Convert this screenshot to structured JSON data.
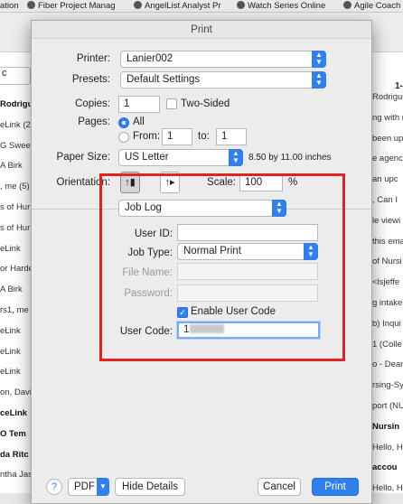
{
  "bookmarks": [
    {
      "label": "ation",
      "icon": "bookmark-icon"
    },
    {
      "label": "Fiber Project Manag",
      "icon": "bookmark-icon"
    },
    {
      "label": "AngelList Analyst Pr",
      "icon": "angellist-icon"
    },
    {
      "label": "Watch Series Online",
      "icon": "bookmark-icon"
    },
    {
      "label": "Agile Coach",
      "icon": "spotify-icon"
    }
  ],
  "background": {
    "search_text": "c",
    "right_header": "1-",
    "left_rows": [
      {
        "text": "Rodrigu",
        "bold": true
      },
      {
        "text": "eLink (2",
        "bold": false
      },
      {
        "text": "G Swee",
        "bold": false
      },
      {
        "text": "A Birk",
        "bold": false
      },
      {
        "text": ", me (5)",
        "bold": false
      },
      {
        "text": "s of Hur",
        "bold": false
      },
      {
        "text": "s of Hur",
        "bold": false
      },
      {
        "text": "eLink",
        "bold": false
      },
      {
        "text": "or Harde",
        "bold": false
      },
      {
        "text": "A Birk",
        "bold": false
      },
      {
        "text": "rs1, me",
        "bold": false
      },
      {
        "text": "eLink",
        "bold": false
      },
      {
        "text": "eLink",
        "bold": false
      },
      {
        "text": "eLink",
        "bold": false
      },
      {
        "text": "on, David",
        "bold": false
      },
      {
        "text": "ceLink",
        "bold": true
      },
      {
        "text": "O Tem",
        "bold": true
      },
      {
        "text": "da Ritc",
        "bold": true
      },
      {
        "text": "ntha Jas",
        "bold": false
      }
    ],
    "right_rows": [
      {
        "text": "Rodrigue",
        "bold": false
      },
      {
        "text": "ng with re",
        "bold": false
      },
      {
        "text": "been upo",
        "bold": false
      },
      {
        "text": "e agenc",
        "bold": false
      },
      {
        "text": "an upc",
        "bold": false
      },
      {
        "text": ", Can I",
        "bold": false
      },
      {
        "text": "le viewi",
        "bold": false
      },
      {
        "text": "this ema",
        "bold": false
      },
      {
        "text": "of Nursi",
        "bold": false
      },
      {
        "text": "<lsjeffe",
        "bold": false
      },
      {
        "text": "g intake",
        "bold": false
      },
      {
        "text": "b) Inqui",
        "bold": false
      },
      {
        "text": "1 (Colle",
        "bold": false
      },
      {
        "text": "o - Dean",
        "bold": false
      },
      {
        "text": "rsing-Sy",
        "bold": false
      },
      {
        "text": "port (NU",
        "bold": false
      },
      {
        "text": "Nursin",
        "bold": true
      },
      {
        "text": "Hello, Hi",
        "bold": false
      },
      {
        "text": "accou",
        "bold": true
      },
      {
        "text": "Hello, H",
        "bold": false
      }
    ]
  },
  "dialog": {
    "title": "Print",
    "printer_label": "Printer:",
    "printer_value": "Lanier002",
    "presets_label": "Presets:",
    "presets_value": "Default Settings",
    "copies_label": "Copies:",
    "copies_value": "1",
    "two_sided_label": "Two-Sided",
    "two_sided_checked": false,
    "pages_label": "Pages:",
    "pages_all_label": "All",
    "pages_from_label": "From:",
    "pages_from_value": "1",
    "pages_to_label": "to:",
    "pages_to_value": "1",
    "paper_size_label": "Paper Size:",
    "paper_size_value": "US Letter",
    "paper_size_desc": "8.50 by 11.00 inches",
    "orientation_label": "Orientation:",
    "scale_label": "Scale:",
    "scale_value": "100",
    "scale_unit": "%",
    "section_value": "Job Log",
    "user_id_label": "User ID:",
    "user_id_value": "",
    "job_type_label": "Job Type:",
    "job_type_value": "Normal Print",
    "file_name_label": "File Name:",
    "file_name_value": "",
    "password_label": "Password:",
    "password_value": "",
    "enable_user_code_label": "Enable User Code",
    "enable_user_code_checked": true,
    "user_code_label": "User Code:",
    "user_code_value": "1",
    "help_label": "?",
    "pdf_label": "PDF",
    "hide_details_label": "Hide Details",
    "cancel_label": "Cancel",
    "print_label": "Print",
    "accent_color": "#2f7ff0",
    "highlight_color": "#e02424"
  }
}
